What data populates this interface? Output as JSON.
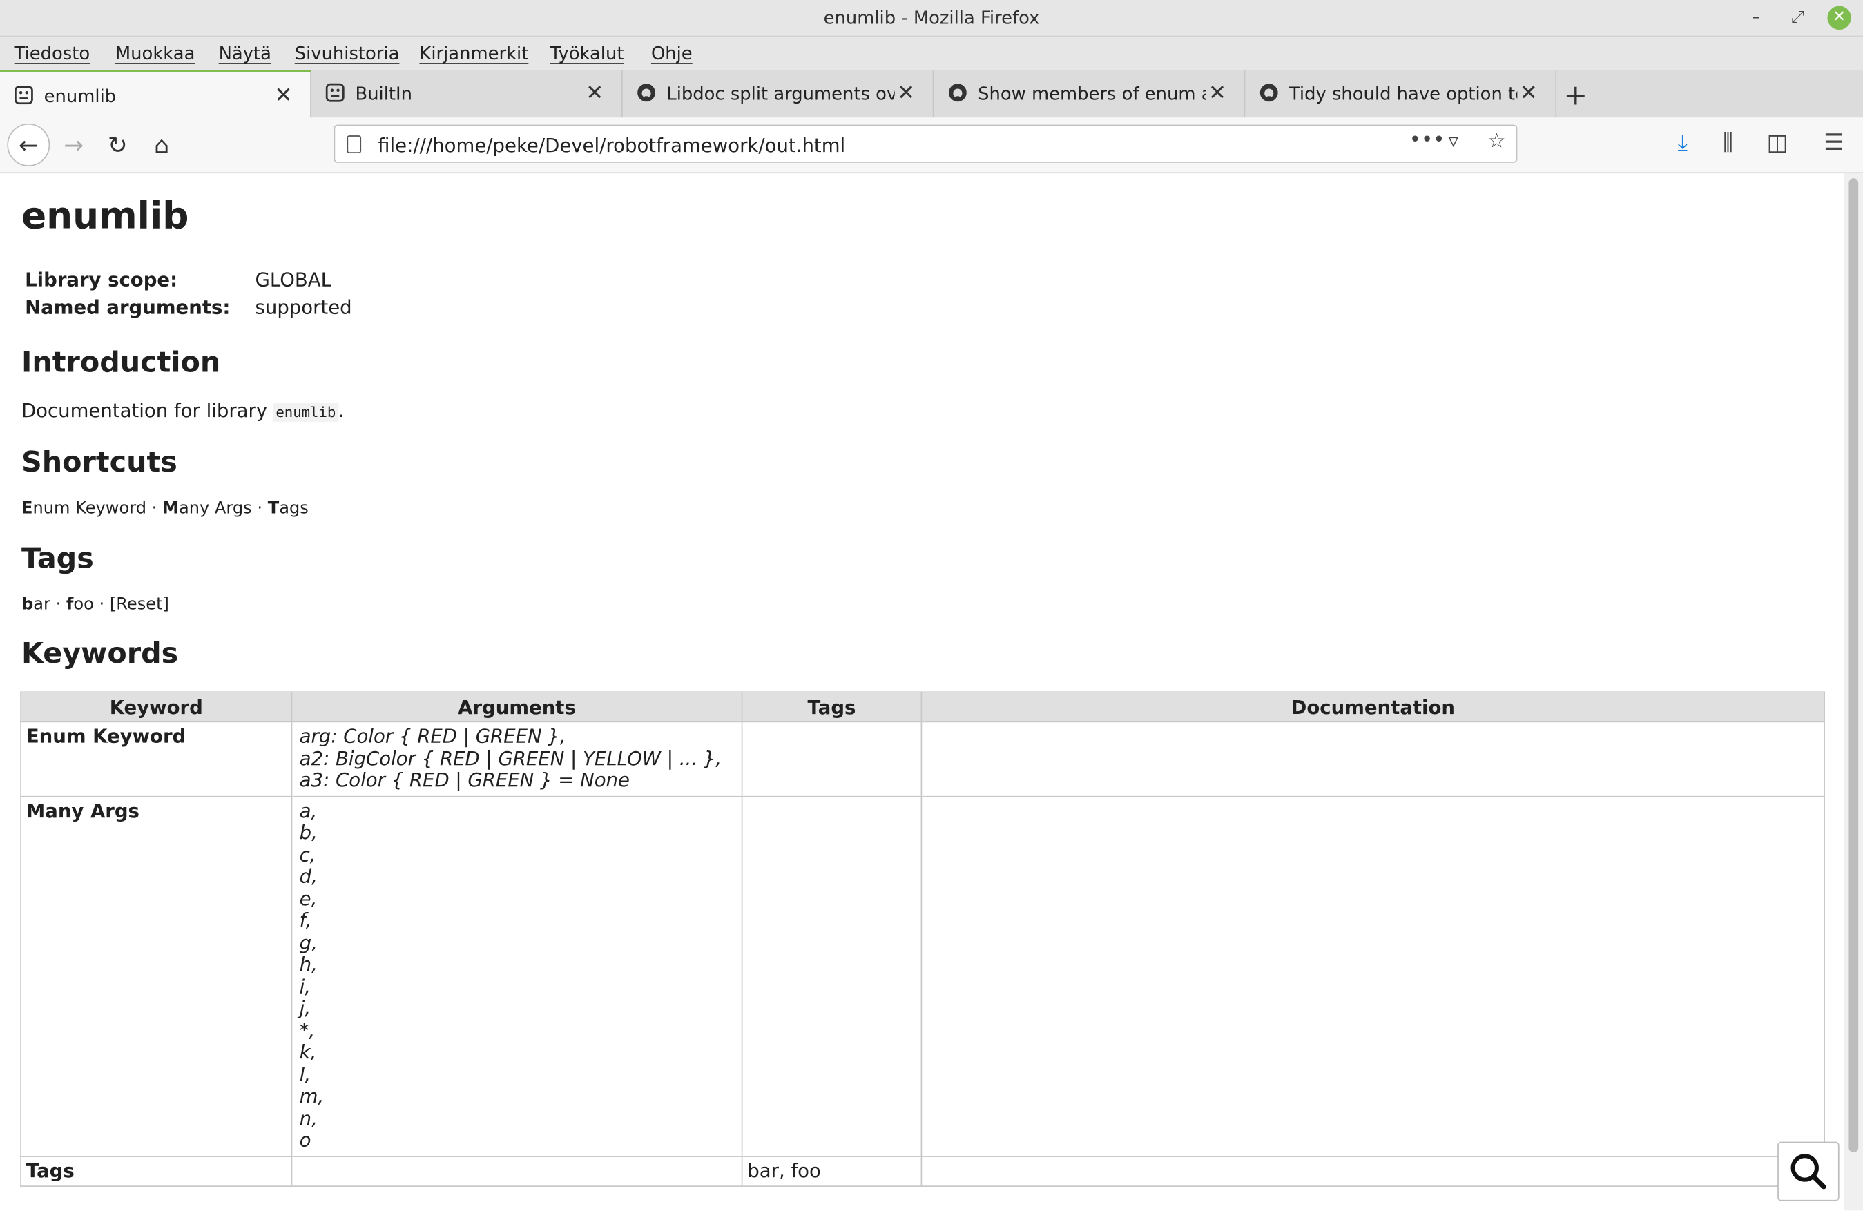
{
  "window": {
    "title": "enumlib - Mozilla Firefox"
  },
  "menu": {
    "items": [
      "Tiedosto",
      "Muokkaa",
      "Näytä",
      "Sivuhistoria",
      "Kirjanmerkit",
      "Työkalut",
      "Ohje"
    ]
  },
  "tabs": [
    {
      "label": "enumlib",
      "icon": "robot-icon",
      "active": true
    },
    {
      "label": "BuiltIn",
      "icon": "robot-icon",
      "active": false
    },
    {
      "label": "Libdoc split arguments over",
      "icon": "github-icon",
      "active": false
    },
    {
      "label": "Show members of enum arg",
      "icon": "github-icon",
      "active": false
    },
    {
      "label": "Tidy should have option to",
      "icon": "github-icon",
      "active": false
    }
  ],
  "navbar": {
    "url": "file:///home/peke/Devel/robotframework/out.html"
  },
  "content": {
    "title": "enumlib",
    "meta": [
      {
        "label": "Library scope:",
        "value": "GLOBAL"
      },
      {
        "label": "Named arguments:",
        "value": "supported"
      }
    ],
    "introduction": {
      "heading": "Introduction",
      "text_before": "Documentation for library ",
      "code": "enumlib",
      "text_after": "."
    },
    "shortcuts": {
      "heading": "Shortcuts",
      "items": [
        {
          "first": "E",
          "rest": "num Keyword"
        },
        {
          "first": "M",
          "rest": "any Args"
        },
        {
          "first": "T",
          "rest": "ags"
        }
      ],
      "separator": " · "
    },
    "tags": {
      "heading": "Tags",
      "items": [
        {
          "first": "b",
          "rest": "ar"
        },
        {
          "first": "f",
          "rest": "oo"
        }
      ],
      "reset": "[Reset]"
    },
    "keywords": {
      "heading": "Keywords",
      "columns": [
        "Keyword",
        "Arguments",
        "Tags",
        "Documentation"
      ],
      "rows": [
        {
          "name": "Enum Keyword",
          "args": [
            "arg: Color { RED | GREEN },",
            "a2: BigColor { RED | GREEN | YELLOW | ... },",
            "a3: Color { RED | GREEN } = None"
          ],
          "tags": "",
          "doc": ""
        },
        {
          "name": "Many Args",
          "args": [
            "a,",
            "b,",
            "c,",
            "d,",
            "e,",
            "f,",
            "g,",
            "h,",
            "i,",
            "j,",
            "*,",
            "k,",
            "l,",
            "m,",
            "n,",
            "o"
          ],
          "tags": "",
          "doc": ""
        },
        {
          "name": "Tags",
          "args": [],
          "tags": "bar, foo",
          "doc": ""
        }
      ]
    }
  },
  "colors": {
    "accent": "#7fbd4e",
    "download": "#1a7fe0"
  }
}
